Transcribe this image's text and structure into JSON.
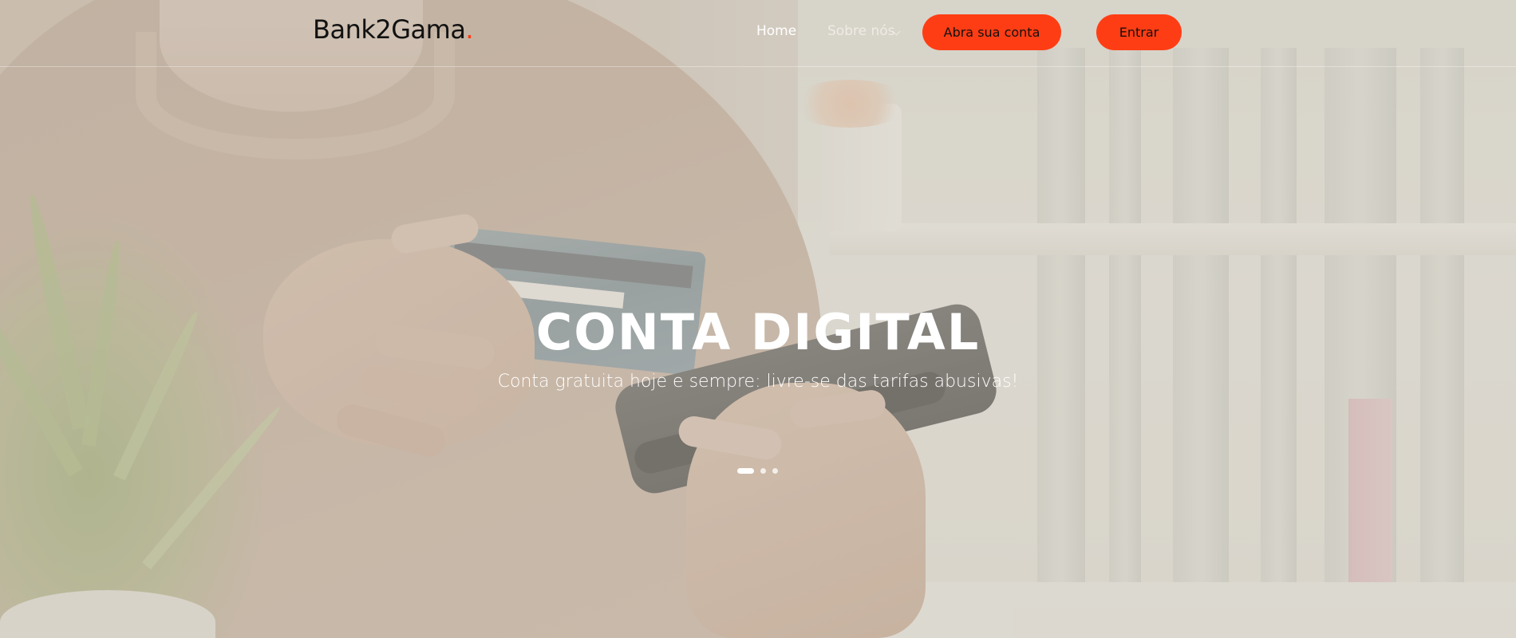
{
  "brand": {
    "name": "Bank2Gama",
    "dot": ".",
    "accent_color": "#ff3d14"
  },
  "nav": {
    "home": "Home",
    "about": "Sobre nós",
    "about_icon": "chevron-down-icon",
    "open_account": "Abra sua conta",
    "login": "Entrar"
  },
  "hero": {
    "title": "CONTA DIGITAL",
    "subtitle": "Conta gratuita hoje e sempre: livre-se das tarifas abusivas!",
    "slides": {
      "count": 3,
      "active": 1
    }
  }
}
